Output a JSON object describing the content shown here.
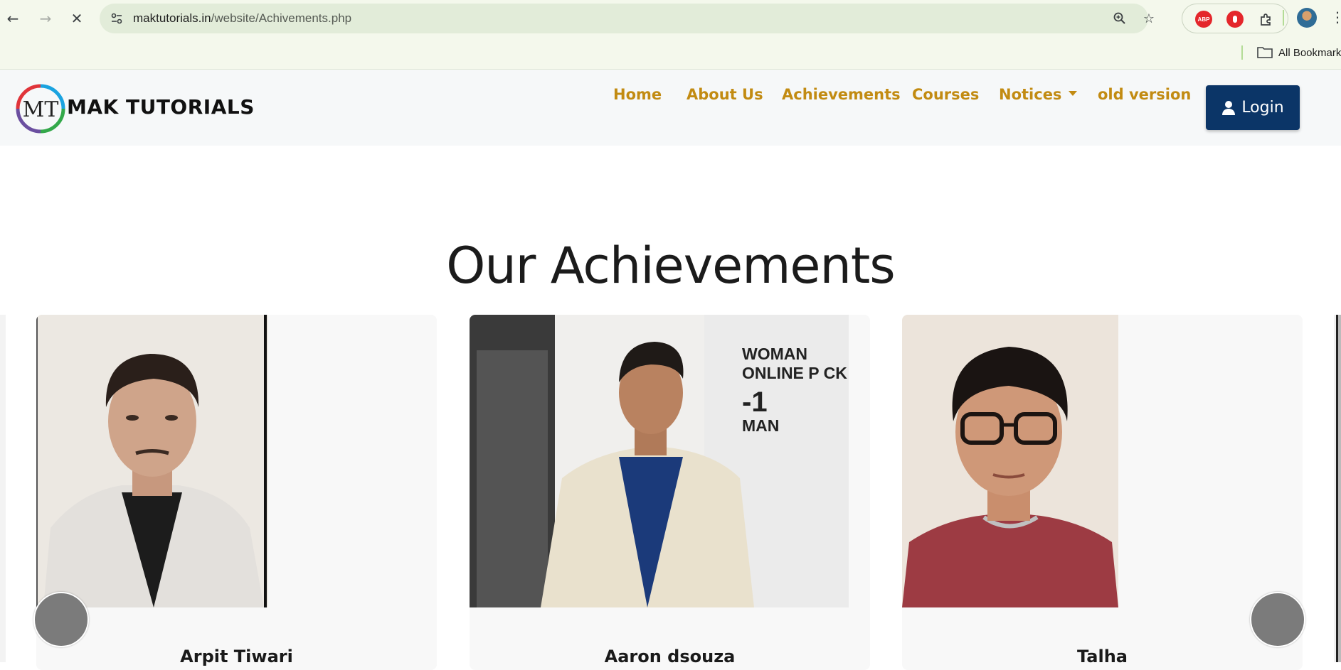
{
  "browser": {
    "url_domain": "maktutorials.in",
    "url_path": "/website/Achivements.php",
    "bookmarks_label": "All Bookmarks",
    "extensions": [
      {
        "name": "abp-icon",
        "label": "ABP",
        "color": "#e4262b"
      },
      {
        "name": "stop-hand-icon",
        "label": "",
        "color": "#e4262b"
      }
    ]
  },
  "header": {
    "brand": "MAK TUTORIALS",
    "logo_letters": "MT",
    "menu": [
      {
        "label": "Home"
      },
      {
        "label": "About Us"
      },
      {
        "label": "Achievements"
      },
      {
        "label": "Courses"
      },
      {
        "label": "Notices"
      },
      {
        "label": "old version"
      }
    ],
    "login_label": "Login",
    "accent_color": "#c28b12",
    "button_color": "#0b3567"
  },
  "main": {
    "title": "Our Achievements",
    "cards": [
      {
        "name": "Arpit Tiwari"
      },
      {
        "name": "Aaron dsouza"
      },
      {
        "name": "Talha"
      }
    ],
    "photo_signs": [
      "WOMAN",
      "ONLINE P CK",
      "-1",
      "MAN"
    ]
  }
}
